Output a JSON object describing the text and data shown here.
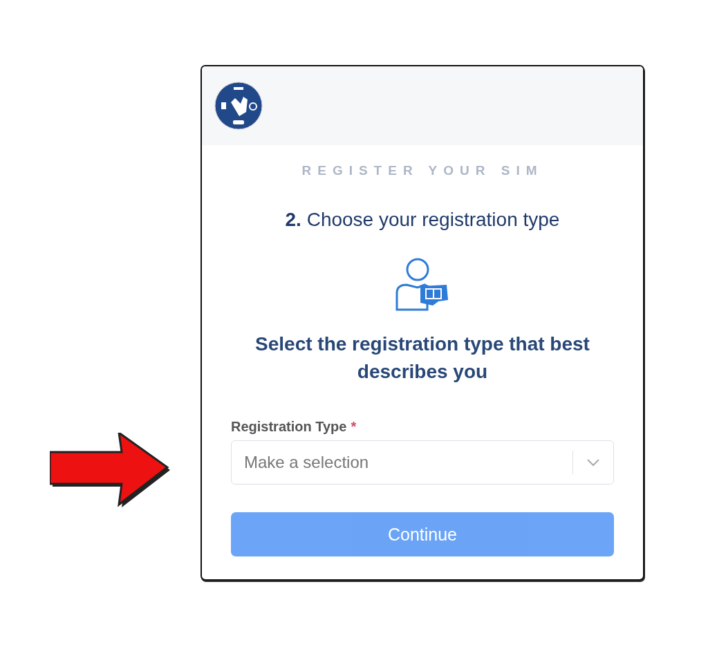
{
  "card": {
    "eyebrow": "REGISTER YOUR SIM",
    "step_title": "**2.** Choose your registration type",
    "description": "Select the registration type that best describes you"
  },
  "field": {
    "label": "Registration Type",
    "required_mark": "*",
    "placeholder": "Make a selection"
  },
  "button": {
    "label": "Continue",
    "disabled": true
  }
}
